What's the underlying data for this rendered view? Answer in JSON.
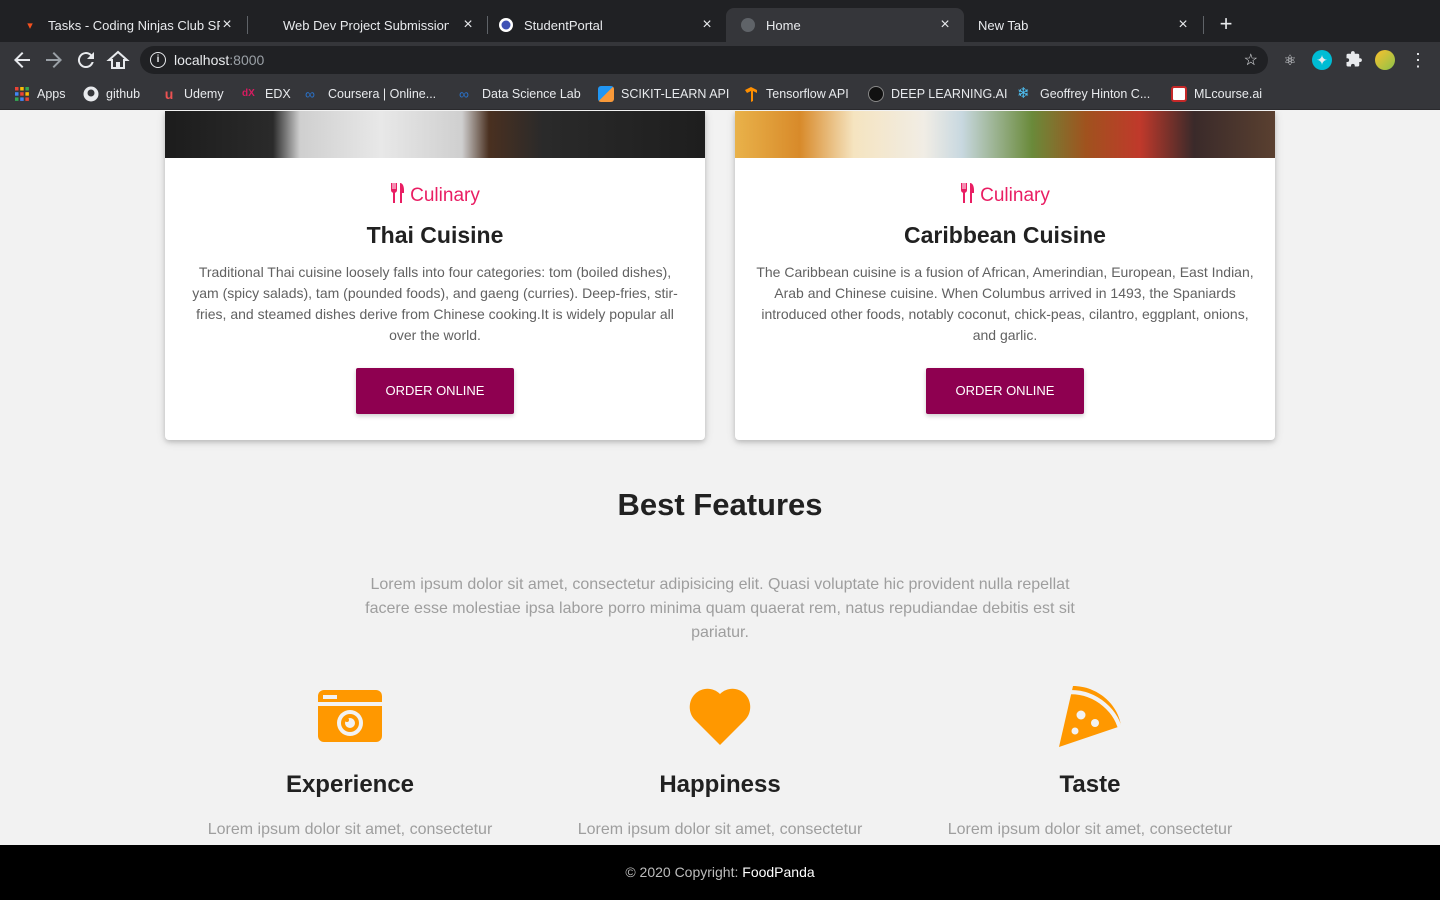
{
  "browser": {
    "tabs": [
      {
        "title": "Tasks - Coding Ninjas Club SRM",
        "active": false
      },
      {
        "title": "Web Dev Project Submission",
        "active": false
      },
      {
        "title": "StudentPortal",
        "active": false
      },
      {
        "title": "Home",
        "active": true
      },
      {
        "title": "New Tab",
        "active": false
      }
    ],
    "address": {
      "host": "localhost",
      "port": ":8000"
    },
    "bookmarks": [
      {
        "label": "Apps",
        "color": "#e53935"
      },
      {
        "label": "github",
        "color": "#ffffff"
      },
      {
        "label": "Udemy",
        "color": "#ec5252"
      },
      {
        "label": "EDX",
        "color": "#02262b"
      },
      {
        "label": "Coursera | Online...",
        "color": "#2a73cc"
      },
      {
        "label": "Data Science Lab",
        "color": "#2a73cc"
      },
      {
        "label": "SCIKIT-LEARN API",
        "color": "#f89939"
      },
      {
        "label": "Tensorflow API",
        "color": "#ff8f00"
      },
      {
        "label": "DEEP LEARNING.AI",
        "color": "#111111"
      },
      {
        "label": "Geoffrey Hinton C...",
        "color": "#4fc3f7"
      },
      {
        "label": "MLcourse.ai",
        "color": "#c62828"
      }
    ]
  },
  "cards": [
    {
      "category": "Culinary",
      "title": "Thai Cuisine",
      "description": "Traditional Thai cuisine loosely falls into four categories: tom (boiled dishes), yam (spicy salads), tam (pounded foods), and gaeng (curries). Deep-fries, stir-fries, and steamed dishes derive from Chinese cooking.It is widely popular all over the world.",
      "button": "ORDER ONLINE"
    },
    {
      "category": "Culinary",
      "title": "Caribbean Cuisine",
      "description": "The Caribbean cuisine is a fusion of African, Amerindian, European, East Indian, Arab and Chinese cuisine. When Columbus arrived in 1493, the Spaniards introduced other foods, notably coconut, chick-peas, cilantro, eggplant, onions, and garlic.",
      "button": "ORDER ONLINE"
    }
  ],
  "features": {
    "title": "Best Features",
    "description": "Lorem ipsum dolor sit amet, consectetur adipisicing elit. Quasi voluptate hic provident nulla repellat facere esse molestiae ipsa labore porro minima quam quaerat rem, natus repudiandae debitis est sit pariatur.",
    "items": [
      {
        "icon": "camera-icon",
        "title": "Experience",
        "text": "Lorem ipsum dolor sit amet, consectetur"
      },
      {
        "icon": "heart-icon",
        "title": "Happiness",
        "text": "Lorem ipsum dolor sit amet, consectetur"
      },
      {
        "icon": "pizza-icon",
        "title": "Taste",
        "text": "Lorem ipsum dolor sit amet, consectetur"
      }
    ],
    "accent_color": "#ff9800"
  },
  "footer": {
    "copyright": "© 2020 Copyright:",
    "brand": "FoodPanda"
  }
}
